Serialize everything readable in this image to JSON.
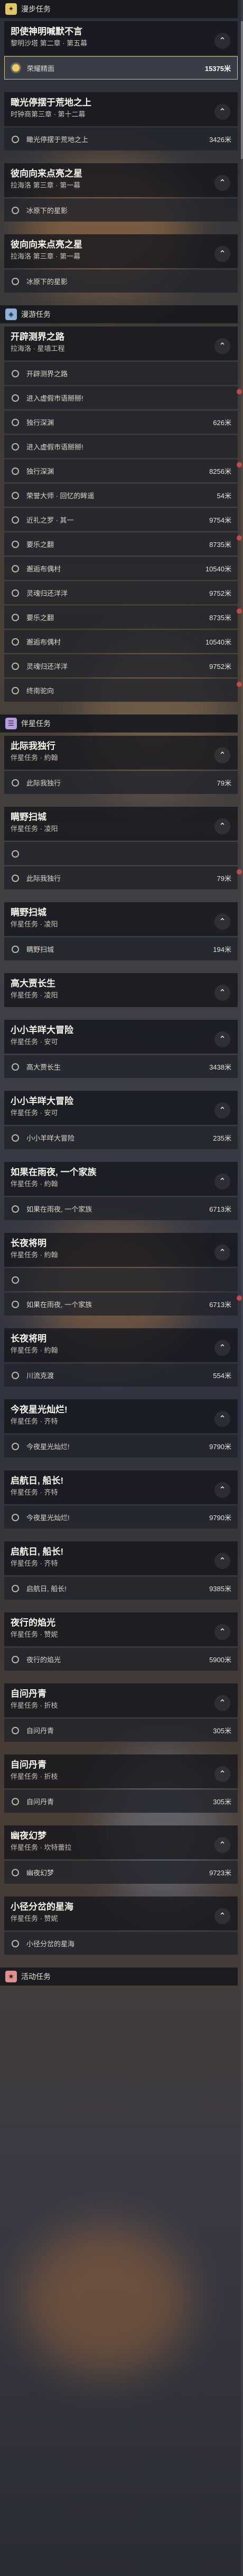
{
  "sections": {
    "main": "漫步任务",
    "explore": "漫游任务",
    "side": "伴星任务",
    "event": "活动任务"
  },
  "quests": [
    {
      "title": "即使神明喊默不言",
      "sub": "黎明沙塔 第二章 · 第五幕",
      "steps": [
        {
          "label": "荣耀精面",
          "dist": "15375米",
          "active": true
        }
      ]
    },
    {
      "title": "瞰光停摆于荒地之上",
      "sub": "时钟商第三章 · 第十二幕",
      "steps": [
        {
          "label": "瞰光停摆于荒地之上",
          "dist": "3426米"
        }
      ]
    },
    {
      "title": "彼向向来点亮之星",
      "sub": "拉海洛 第三章 · 第一幕",
      "steps": [
        {
          "label": "冰原下的星影",
          "dist": ""
        }
      ]
    },
    {
      "title": "彼向向来点亮之星",
      "sub": "拉海洛 第三章 · 第一幕",
      "steps": [
        {
          "label": "冰原下的星影",
          "dist": ""
        }
      ]
    },
    {
      "title": "开辟测界之路",
      "sub": "拉海洛 · 星墙工程",
      "steps": [
        {
          "label": "开辟测界之路",
          "dist": ""
        },
        {
          "label": "进入虚假市语掰掰!",
          "dist": ""
        },
        {
          "label": "独行深渊",
          "dist": "626米"
        },
        {
          "label": "进入虚假市语掰掰!",
          "dist": ""
        },
        {
          "label": "独行深渊",
          "dist": "8256米"
        },
        {
          "label": "荣誉大师 · 回忆的眸遥",
          "dist": "54米"
        },
        {
          "label": "近礼之罗 · 其一",
          "dist": "9754米"
        },
        {
          "label": "要乐之翻",
          "dist": "8735米"
        },
        {
          "label": "邂逅布偶村",
          "dist": "10540米"
        },
        {
          "label": "灵魂归还洋洋",
          "dist": "9752米"
        },
        {
          "label": "要乐之翻",
          "dist": "8735米"
        },
        {
          "label": "邂逅布偶村",
          "dist": "10540米"
        },
        {
          "label": "灵魂归还洋洋",
          "dist": "9752米"
        },
        {
          "label": "终南驼向",
          "dist": ""
        }
      ]
    },
    {
      "title": "此际我独行",
      "sub": "伴星任务 · 約翰",
      "steps": [
        {
          "label": "此际我独行",
          "dist": "79米"
        }
      ]
    },
    {
      "title": "瞒野扫城",
      "sub": "伴星任务 · 凌阳",
      "steps": [
        {
          "label": "",
          "dist": ""
        },
        {
          "label": "此际我独行",
          "dist": "79米"
        }
      ]
    },
    {
      "title": "瞒野扫城",
      "sub": "伴星任务 · 凌阳",
      "steps": [
        {
          "label": "瞒野扫城",
          "dist": "194米"
        }
      ]
    },
    {
      "title": "高大贾长生",
      "sub": "伴星任务 · 凌阳",
      "steps": []
    },
    {
      "title": "小小羊咩大冒险",
      "sub": "伴星任务 · 安可",
      "steps": [
        {
          "label": "高大贾长生",
          "dist": "3438米"
        }
      ]
    },
    {
      "title": "小小羊咩大冒险",
      "sub": "伴星任务 · 安可",
      "steps": [
        {
          "label": "小小羊咩大冒险",
          "dist": "235米"
        }
      ]
    },
    {
      "title": "如果在雨夜, 一个家族",
      "sub": "伴星任务 · 約翰",
      "steps": [
        {
          "label": "如果在雨夜, 一个家族",
          "dist": "6713米"
        }
      ]
    },
    {
      "title": "长夜将明",
      "sub": "伴星任务 · 約翰",
      "steps": [
        {
          "label": "",
          "dist": ""
        },
        {
          "label": "如果在雨夜, 一个家族",
          "dist": "6713米"
        }
      ]
    },
    {
      "title": "长夜将明",
      "sub": "伴星任务 · 約翰",
      "steps": [
        {
          "label": "川流克渡",
          "dist": "554米"
        }
      ]
    },
    {
      "title": "今夜星光灿烂!",
      "sub": "伴星任务 · 齐特",
      "steps": [
        {
          "label": "今夜星光灿烂!",
          "dist": "9790米"
        }
      ]
    },
    {
      "title": "启航日, 船长!",
      "sub": "伴星任务 · 齐特",
      "steps": [
        {
          "label": "今夜星光灿烂!",
          "dist": "9790米"
        }
      ]
    },
    {
      "title": "启航日, 船长!",
      "sub": "伴星任务 · 齐特",
      "steps": [
        {
          "label": "启航日, 船长!",
          "dist": "9385米"
        }
      ]
    },
    {
      "title": "夜行的焰光",
      "sub": "伴星任务 · 赞妮",
      "steps": [
        {
          "label": "夜行的焰光",
          "dist": "5900米"
        }
      ]
    },
    {
      "title": "自问丹青",
      "sub": "伴星任务 · 折枝",
      "steps": [
        {
          "label": "自问丹青",
          "dist": "305米"
        }
      ]
    },
    {
      "title": "自问丹青",
      "sub": "伴星任务 · 折枝",
      "steps": [
        {
          "label": "自问丹青",
          "dist": "305米"
        }
      ]
    },
    {
      "title": "幽夜幻梦",
      "sub": "伴星任务 · 坎特蕾拉",
      "steps": [
        {
          "label": "幽夜幻梦",
          "dist": "9723米"
        }
      ]
    },
    {
      "title": "小径分岔的星海",
      "sub": "伴星任务 · 赞妮",
      "steps": [
        {
          "label": "小径分岔的星海",
          "dist": ""
        }
      ]
    }
  ],
  "colors": {
    "accent": "#e8cf6a",
    "main_icon": "#e2c563",
    "explore_icon": "#8fb0d8",
    "side_icon": "#b79be0",
    "event_icon": "#e08f8f"
  },
  "icons": {
    "collapse": "chevron-up-icon"
  }
}
